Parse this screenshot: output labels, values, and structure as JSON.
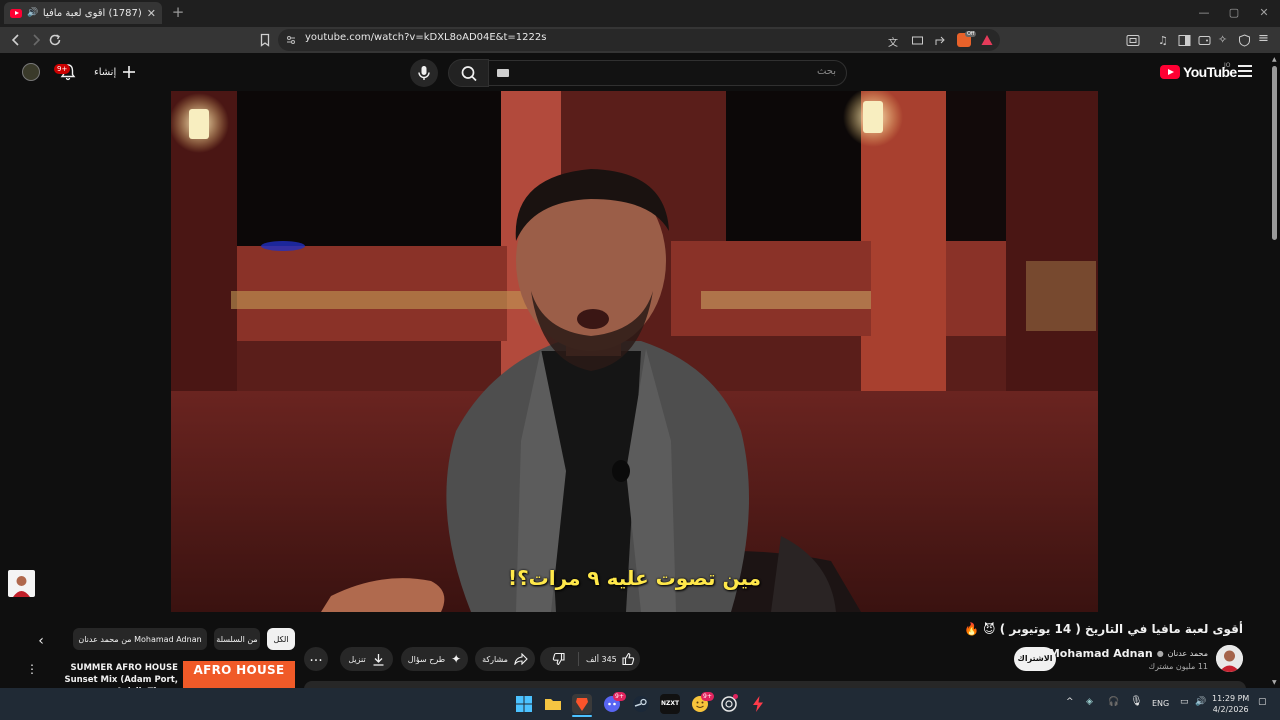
{
  "browser": {
    "tab_title": "(1787) أقوى لعبة مافيا في التا...",
    "new_tab_icon": "plus-icon",
    "url": "youtube.com/watch?v=kDXL8oAD04E&t=1222s",
    "extension_badge": "Off"
  },
  "youtube": {
    "logo_text": "YouTube",
    "region": "JO",
    "search_placeholder": "بحث",
    "create_label": "إنشاء",
    "notifications_badge": "9+"
  },
  "video": {
    "subtitle": "مين تصوت عليه ٩ مرات؟!",
    "title": "أقوى لعبة مافيا في التاريخ ( 14 يوتيوبر ) 😈 🔥",
    "channel_name_ar": "محمد عدنان",
    "channel_name_en": "Mohamad Adnan",
    "subscribers": "11 مليون مشترك",
    "subscribe_label": "الاشتراك",
    "like_count": "345 ألف",
    "share_label": "مشاركة",
    "ask_label": "طرح سؤال",
    "download_label": "تنزيل",
    "more_label": "..."
  },
  "sidebar": {
    "chips": [
      {
        "label": "الكل",
        "active": true
      },
      {
        "label": "من السلسلة",
        "active": false
      },
      {
        "label": "من محمد عدنان Mohamad Adnan",
        "active": false
      }
    ],
    "recommendation": {
      "title": "SUMMER AFRO HOUSE Sunset Mix (Adam Port, Avicii, The ...",
      "thumb_text": "AFRO HOUSE"
    }
  },
  "taskbar": {
    "badges": {
      "discord": "9+",
      "emoji_app": "9+"
    },
    "lang": "ENG",
    "time": "11:29 PM",
    "date": "4/2/2026"
  }
}
